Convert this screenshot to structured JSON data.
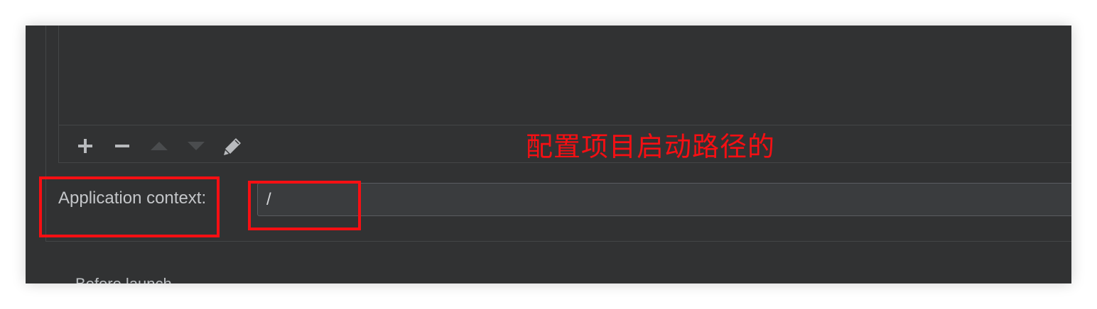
{
  "list_toolbar": {
    "icons": [
      "plus-icon",
      "minus-icon",
      "move-up-icon",
      "move-down-icon",
      "edit-pencil-icon"
    ]
  },
  "application_context": {
    "label": "Application context:",
    "value": "/"
  },
  "below_partial_text": "Before launch",
  "annotation": {
    "text": "配置项目启动路径的",
    "color": "#f70f13"
  },
  "colors": {
    "background": "#313233",
    "border": "#444647",
    "label_text": "#c4c6c9",
    "active_icon": "#b8babd",
    "disabled_icon": "#4a4c4e"
  }
}
